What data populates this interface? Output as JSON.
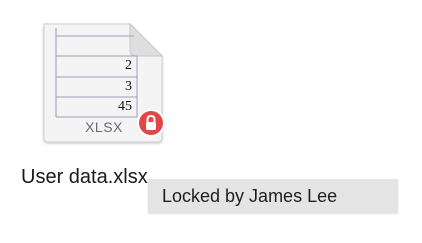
{
  "file": {
    "name": "User data.xlsx",
    "extension": "XLSX",
    "cell_values": [
      "2",
      "3",
      "45"
    ],
    "locked": true,
    "icon": "spreadsheet-document-icon",
    "lock_icon": "lock-icon"
  },
  "tooltip": {
    "text": "Locked by James Lee"
  },
  "colors": {
    "lock_badge": "#e04848",
    "tooltip_background": "#e4e4e4",
    "grid_lines": "#9aa0b5"
  }
}
